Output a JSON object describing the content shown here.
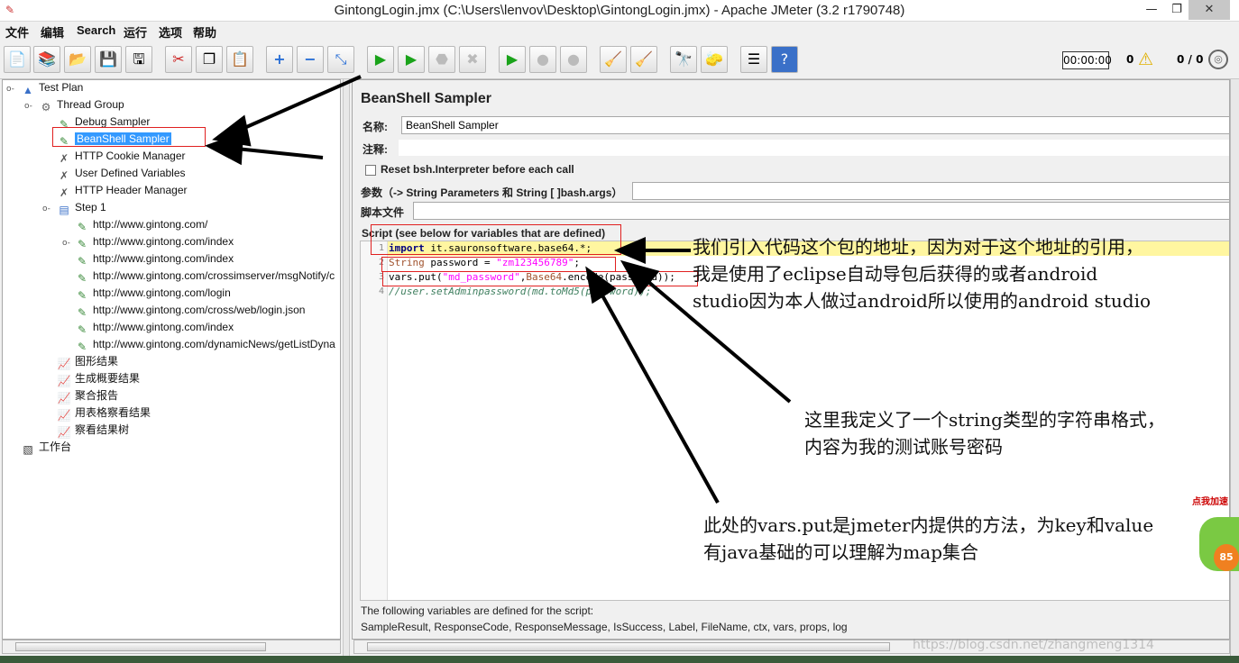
{
  "window": {
    "title": "GintongLogin.jmx (C:\\Users\\lenvov\\Desktop\\GintongLogin.jmx) - Apache JMeter (3.2 r1790748)"
  },
  "menu": [
    "文件",
    "编辑",
    "Search",
    "运行",
    "选项",
    "帮助"
  ],
  "toolbar": {
    "icons": [
      "new-icon",
      "templates-icon",
      "open-icon",
      "save-icon",
      "save-as-icon",
      "cut-icon",
      "copy-icon",
      "paste-icon",
      "expand-icon",
      "collapse-icon",
      "toggle-icon",
      "start-icon",
      "start-no-pause-icon",
      "stop-icon",
      "shutdown-icon",
      "remote-start-icon",
      "remote-stop-icon",
      "remote-shutdown-icon",
      "clear-icon",
      "clear-all-icon",
      "search-icon",
      "reset-search-icon",
      "function-helper-icon",
      "help-icon"
    ],
    "timer": "00:00:00",
    "error_count": "0",
    "threads_ratio": "0 / 0"
  },
  "tree": {
    "nodes": [
      {
        "label": "Test Plan",
        "icon": "test-plan-icon"
      },
      {
        "label": "Thread Group",
        "icon": "gear-icon"
      },
      {
        "label": "Debug Sampler",
        "icon": "pipette-icon"
      },
      {
        "label": "BeanShell Sampler",
        "icon": "pipette-icon",
        "selected": true
      },
      {
        "label": "HTTP Cookie Manager",
        "icon": "wrench-icon"
      },
      {
        "label": "User Defined Variables",
        "icon": "wrench-icon"
      },
      {
        "label": "HTTP Header Manager",
        "icon": "wrench-icon"
      },
      {
        "label": "Step 1",
        "icon": "controller-icon"
      },
      {
        "label": "http://www.gintong.com/",
        "icon": "pipette-icon"
      },
      {
        "label": "http://www.gintong.com/index",
        "icon": "pipette-icon"
      },
      {
        "label": "http://www.gintong.com/index",
        "icon": "pipette-icon"
      },
      {
        "label": "http://www.gintong.com/crossimserver/msgNotify/c",
        "icon": "pipette-icon"
      },
      {
        "label": "http://www.gintong.com/login",
        "icon": "pipette-icon"
      },
      {
        "label": "http://www.gintong.com/cross/web/login.json",
        "icon": "pipette-icon"
      },
      {
        "label": "http://www.gintong.com/index",
        "icon": "pipette-icon"
      },
      {
        "label": "http://www.gintong.com/dynamicNews/getListDyna",
        "icon": "pipette-icon"
      },
      {
        "label": "图形结果",
        "icon": "graph-icon"
      },
      {
        "label": "生成概要结果",
        "icon": "graph-icon"
      },
      {
        "label": "聚合报告",
        "icon": "graph-icon"
      },
      {
        "label": "用表格察看结果",
        "icon": "graph-icon"
      },
      {
        "label": "察看结果树",
        "icon": "graph-icon"
      },
      {
        "label": "工作台",
        "icon": "workbench-icon"
      }
    ]
  },
  "panel": {
    "title": "BeanShell Sampler",
    "name_label": "名称:",
    "name_value": "BeanShell Sampler",
    "comment_label": "注释:",
    "comment_value": "",
    "reset_label": "Reset bsh.Interpreter before each call",
    "params_label": "参数（-> String Parameters 和 String [ ]bash.args）",
    "params_value": "",
    "script_file_label": "脚本文件",
    "script_file_value": "",
    "script_label": "Script (see below for variables that are defined)",
    "code": {
      "l1_kw": "import",
      "l1_rest": " it.sauronsoftware.base64.*;",
      "l2_type": "String",
      "l2_mid": " password = ",
      "l2_str": "\"zm123456789\"",
      "l2_end": ";",
      "l3_a": "vars.put(",
      "l3_str": "\"md_password\"",
      "l3_b": ",",
      "l3_type": "Base64",
      "l3_c": ".encode(password));",
      "l4": "//user.setAdminpassword(md.toMd5(password));"
    },
    "line_numbers": [
      "1",
      "2",
      "3",
      "4"
    ],
    "vars_line1": "The following variables are defined for the script:",
    "vars_line2": "SampleResult, ResponseCode, ResponseMessage, IsSuccess, Label, FileName, ctx, vars, props, log"
  },
  "annotations": {
    "a1_l1": "我们引入代码这个包的地址，因为对于这个地址的引用，",
    "a1_l2": "我是使用了eclipse自动导包后获得的或者android",
    "a1_l3": "studio因为本人做过android所以使用的android studio",
    "a2_l1": "这里我定义了一个string类型的字符串格式，",
    "a2_l2": "内容为我的测试账号密码",
    "a3_l1": "此处的vars.put是jmeter内提供的方法，为key和value",
    "a3_l2": "有java基础的可以理解为map集合"
  },
  "watermark": "https://blog.csdn.net/zhangmeng1314",
  "float_widget": {
    "label": "点我加速",
    "value": "85"
  }
}
